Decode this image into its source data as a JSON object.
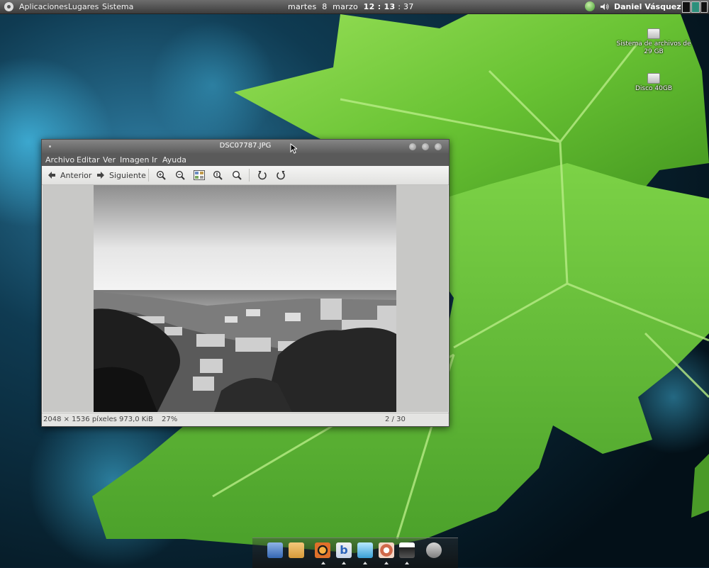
{
  "top_panel": {
    "menus": [
      "Aplicaciones",
      "Lugares",
      "Sistema"
    ],
    "clock": {
      "day": "martes",
      "date": "8",
      "month": "marzo",
      "time": "12 : 13",
      "seconds": ": 37"
    },
    "user": "Daniel Vásquez"
  },
  "desktop_icons": [
    {
      "label": "Sistema de archivos de 29 GB",
      "icon": "drive-icon"
    },
    {
      "label": "Disco 40GB",
      "icon": "drive-icon"
    }
  ],
  "window": {
    "title": "DSC07787.JPG",
    "menu": [
      "Archivo",
      "Editar",
      "Ver",
      "Imagen",
      "Ir",
      "Ayuda"
    ],
    "toolbar": {
      "prev_label": "Anterior",
      "next_label": "Siguiente",
      "icons": [
        "zoom-in-icon",
        "zoom-out-icon",
        "gallery-icon",
        "zoom-normal-icon",
        "zoom-fit-icon",
        "rotate-left-icon",
        "rotate-right-icon"
      ]
    },
    "status": {
      "dimensions": "2048 × 1536 píxeles",
      "size": "973,0 KiB",
      "zoom": "27%",
      "position": "2 / 30"
    }
  },
  "dock": {
    "items": [
      "file-manager-icon",
      "folder-icon",
      "media-player-icon",
      "browser-icon",
      "messenger-icon",
      "audio-icon",
      "screen-icon",
      "trash-icon"
    ]
  }
}
